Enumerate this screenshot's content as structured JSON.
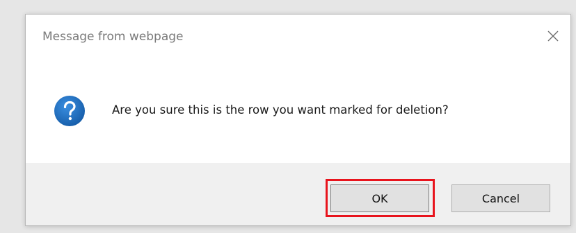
{
  "dialog": {
    "title": "Message from webpage",
    "message": "Are you sure this is the row you want marked for deletion?",
    "icon": "question-icon",
    "close_icon": "close-icon",
    "buttons": {
      "ok_label": "OK",
      "cancel_label": "Cancel"
    },
    "colors": {
      "icon_blue": "#1e6fc0",
      "highlight_red": "#e8141d"
    }
  }
}
